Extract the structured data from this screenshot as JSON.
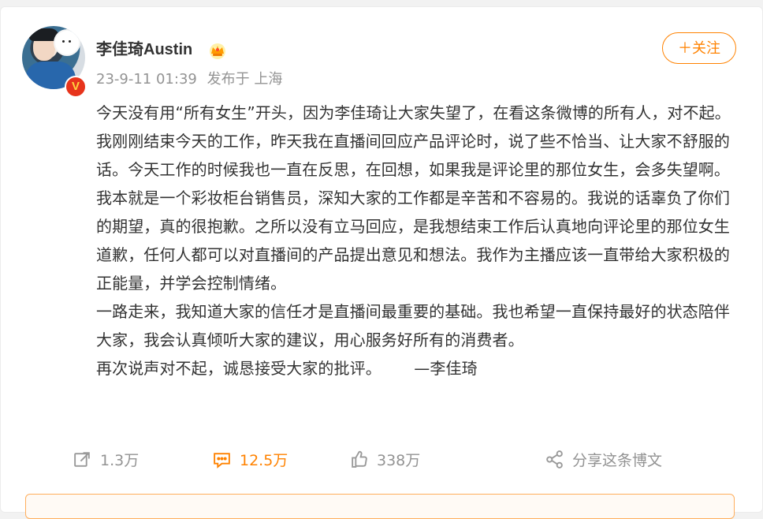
{
  "post": {
    "author": "李佳琦Austin",
    "timestamp": "23-9-11 01:39",
    "location": "发布于 上海",
    "follow_button": "＋关注",
    "verified_mark": "V",
    "crown_icon": "crown-icon",
    "paragraphs": [
      "今天没有用“所有女生”开头，因为李佳琦让大家失望了，在看这条微博的所有人，对不起。",
      "我刚刚结束今天的工作，昨天我在直播间回应产品评论时，说了些不恰当、让大家不舒服的话。今天工作的时候我也一直在反思，在回想，如果我是评论里的那位女生，会多失望啊。",
      "我本就是一个彩妆柜台销售员，深知大家的工作都是辛苦和不容易的。我说的话辜负了你们的期望，真的很抱歉。之所以没有立马回应，是我想结束工作后认真地向评论里的那位女生道歉，任何人都可以对直播间的产品提出意见和想法。我作为主播应该一直带给大家积极的正能量，并学会控制情绪。",
      "一路走来，我知道大家的信任才是直播间最重要的基础。我也希望一直保持最好的状态陪伴大家，我会认真倾听大家的建议，用心服务好所有的消费者。"
    ],
    "last_paragraph": "再次说声对不起，诚恳接受大家的批评。",
    "signoff": "—李佳琦"
  },
  "actions": {
    "repost": {
      "count": "1.3万",
      "icon": "repost-icon"
    },
    "comment": {
      "count": "12.5万",
      "icon": "comment-icon"
    },
    "like": {
      "count": "338万",
      "icon": "like-icon"
    },
    "share": {
      "label": "分享这条博文",
      "icon": "share-icon"
    }
  },
  "colors": {
    "accent": "#ff8200",
    "text": "#333333",
    "muted": "#939393",
    "verified": "#e7341c"
  }
}
